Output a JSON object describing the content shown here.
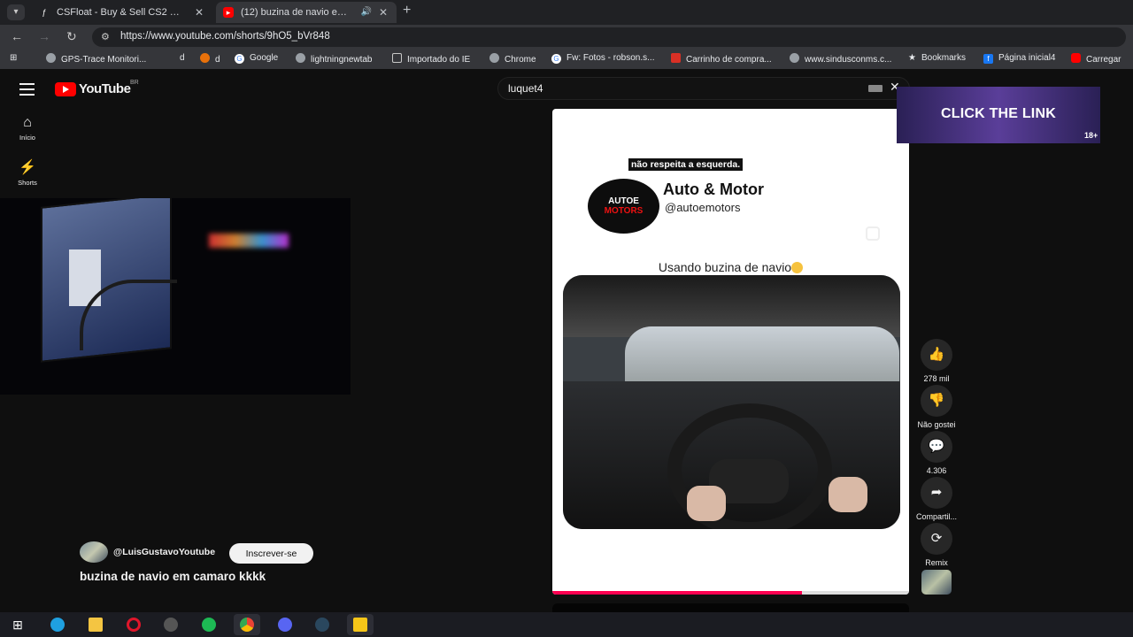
{
  "browser": {
    "tabs": [
      {
        "label": "CSFloat - Buy & Sell CS2 Skins",
        "close": "✕"
      },
      {
        "label": "(12) buzina de navio em camaro kkkk - YouTube",
        "close": "✕",
        "audio": "🔊"
      }
    ],
    "new_tab": "+",
    "url": "https://www.youtube.com/shorts/9hO5_bVr848",
    "bookmarks": [
      "GPS-Trace Monitori...",
      "d",
      "d",
      "Google",
      "lightningnewtab",
      "Importado do IE",
      "Chrome",
      "Fw: Fotos - robson.s...",
      "Carrinho de compra...",
      "www.sindusconms.c...",
      "Bookmarks",
      "Página inicial4",
      "Carregar"
    ]
  },
  "youtube": {
    "logo": "YouTube",
    "country": "BR",
    "nav": [
      {
        "label": "Início"
      },
      {
        "label": "Shorts"
      }
    ],
    "search": {
      "query": "luquet4",
      "clear": "✕"
    }
  },
  "short": {
    "caption_top": "não respeita a esquerda.",
    "channel_name": "Auto & Motor",
    "channel_handle": "@autoemotors",
    "channel_logo_line1": "AUTOE",
    "channel_logo_line2": "MOTORS",
    "video_title": "Usando buzina de navio",
    "progress": 0.7,
    "uploader": "@LuisGustavoYoutube",
    "subscribe_label": "Inscrever-se",
    "title": "buzina de navio em camaro kkkk"
  },
  "ad": {
    "text": "CLICK THE LINK",
    "age": "18+"
  },
  "actions": [
    {
      "icon": "👍",
      "label": "278 mil"
    },
    {
      "icon": "👎",
      "label": "Não gostei"
    },
    {
      "icon": "💬",
      "label": "4.306"
    },
    {
      "icon": "➦",
      "label": "Compartil..."
    },
    {
      "icon": "⟳",
      "label": "Remix"
    }
  ],
  "colors": {
    "youtube_red": "#ff0000",
    "progress": "#ff0050",
    "background": "#0f0f0f"
  }
}
